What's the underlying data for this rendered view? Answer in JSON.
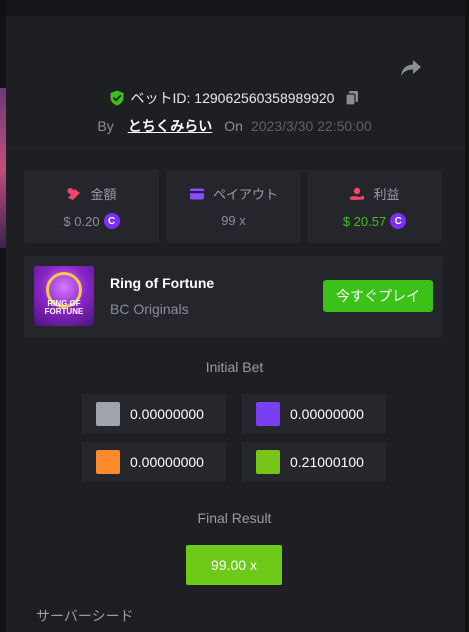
{
  "header": {
    "bet_id_label": "ベットID: 129062560358989920",
    "by_label": "By",
    "username": "とちくみらい",
    "on_label": "On",
    "datetime": "2023/3/30 22:50:00"
  },
  "stats": [
    {
      "label": "金額",
      "value": "$ 0.20",
      "icon": "bet-amount-icon",
      "coin": true,
      "color": "#8b8e96"
    },
    {
      "label": "ペイアウト",
      "value": "99 x",
      "icon": "payout-card-icon",
      "coin": false,
      "color": "#8b8e96"
    },
    {
      "label": "利益",
      "value": "$ 20.57",
      "icon": "profit-hand-icon",
      "coin": true,
      "color": "#3bc117"
    }
  ],
  "game": {
    "title": "Ring of Fortune",
    "subtitle": "BC Originals",
    "play_label": "今すぐプレイ",
    "thumb_text_line1": "RING OF",
    "thumb_text_line2": "FORTUNE"
  },
  "initial_bet": {
    "title": "Initial Bet",
    "cells": [
      {
        "color": "#a0a4ab",
        "value": "0.00000000"
      },
      {
        "color": "#7b3ff2",
        "value": "0.00000000"
      },
      {
        "color": "#ff8a2b",
        "value": "0.00000000"
      },
      {
        "color": "#78c51a",
        "value": "0.21000100"
      }
    ]
  },
  "final_result": {
    "title": "Final Result",
    "value": "99.00 x"
  },
  "server_seed_label": "サーバーシード",
  "colors": {
    "accent_green": "#3bc117",
    "result_green": "#6dca18",
    "coin_purple": "#7b2ff7",
    "panel_bg": "#1e1f23"
  }
}
